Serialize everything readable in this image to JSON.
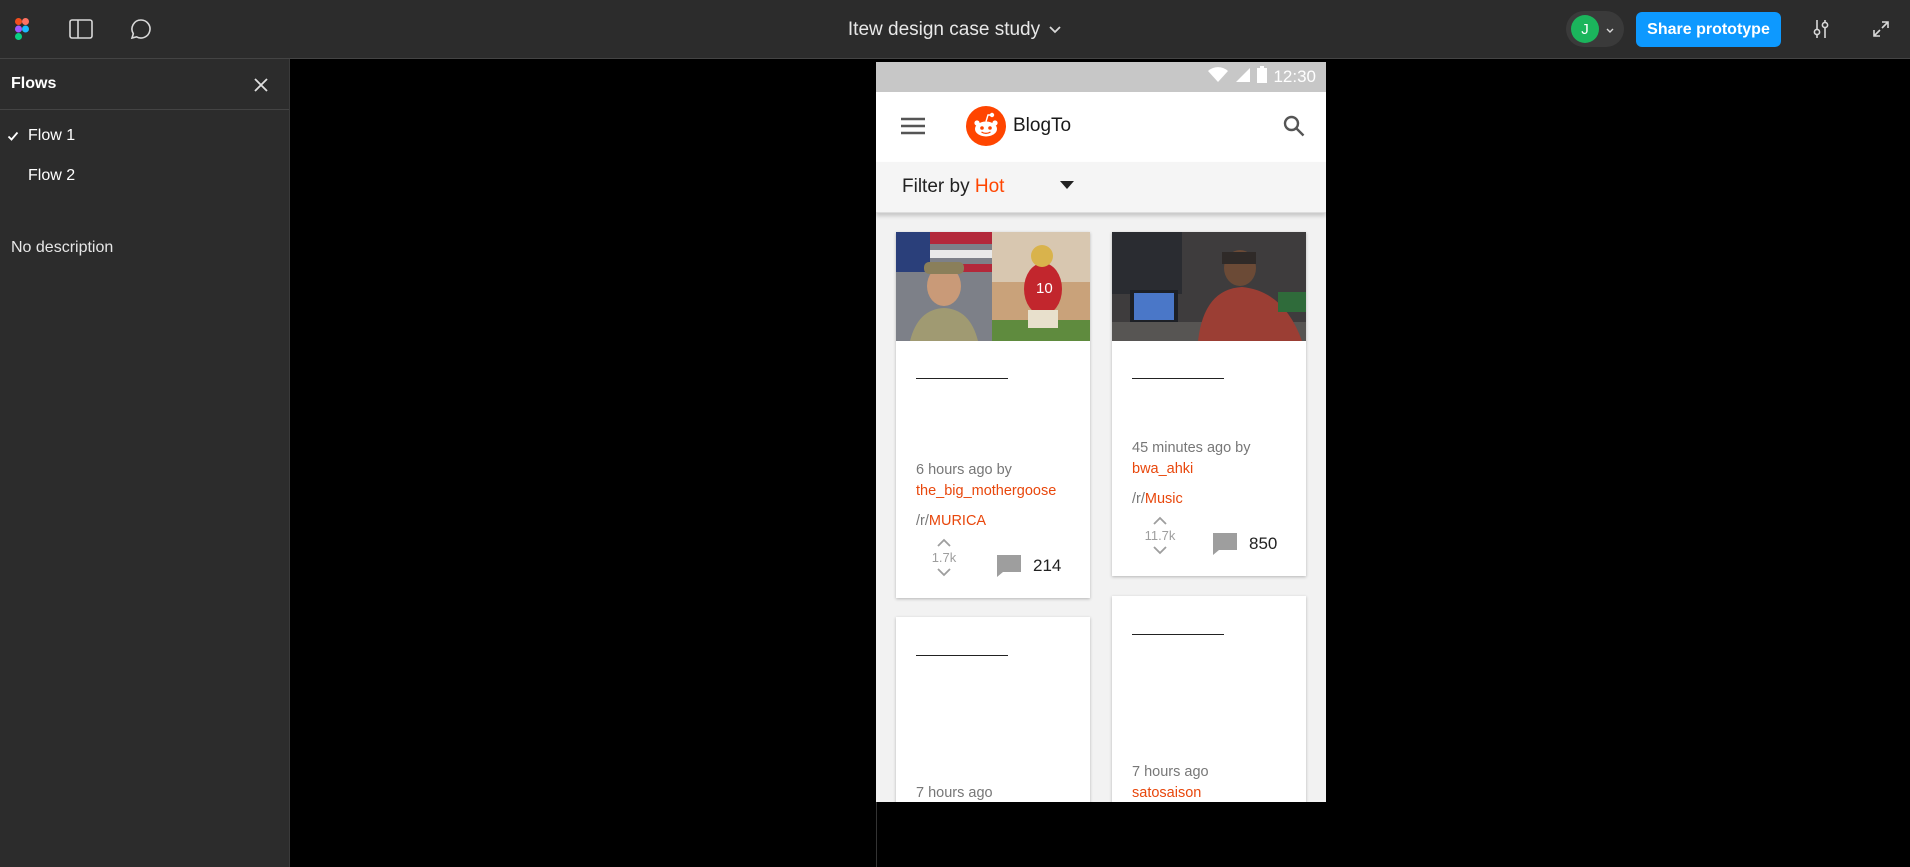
{
  "toolbar": {
    "title": "Itew design case study",
    "avatar_initial": "J",
    "share_label": "Share prototype",
    "icons": [
      "figma-logo-icon",
      "sidebar-toggle-icon",
      "comment-icon",
      "chevron-down-icon",
      "settings-sliders-icon",
      "fullscreen-icon"
    ]
  },
  "sidebar": {
    "title": "Flows",
    "flows": [
      {
        "label": "Flow 1",
        "selected": true
      },
      {
        "label": "Flow 2",
        "selected": false
      }
    ],
    "description": "No description"
  },
  "phone": {
    "status_time": "12:30",
    "brand": "BlogTo",
    "filter_prefix": "Filter by",
    "filter_value": "Hot",
    "cards": [
      {
        "time": "6 hours ago by",
        "author": "the_big_mothergoose",
        "sub_prefix": "/r/",
        "sub": "MURICA",
        "votes": "1.7k",
        "comments": "214"
      },
      {
        "time": "45 minutes ago by",
        "author": "bwa_ahki",
        "sub_prefix": "/r/",
        "sub": "Music",
        "votes": "11.7k",
        "comments": "850"
      },
      {
        "time": "7 hours ago"
      },
      {
        "time": "7 hours ago",
        "author": "satosaison"
      }
    ]
  },
  "colors": {
    "toolbar_bg": "#2c2c2c",
    "share_button": "#0d99ff",
    "avatar": "#1bb55c",
    "brand_accent": "#ff4500"
  }
}
